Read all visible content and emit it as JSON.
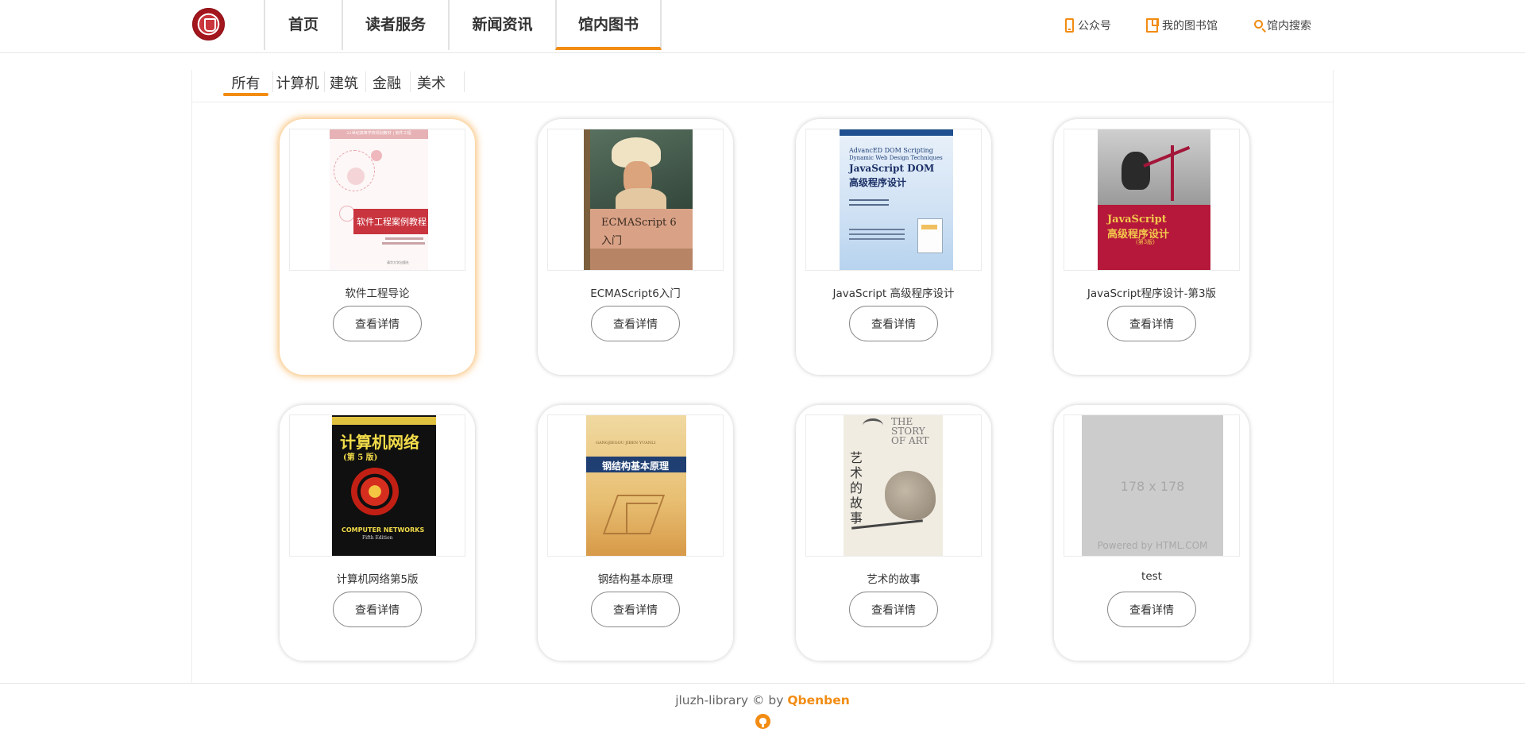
{
  "nav": {
    "items": [
      {
        "label": "首页"
      },
      {
        "label": "读者服务"
      },
      {
        "label": "新闻资讯"
      },
      {
        "label": "馆内图书"
      }
    ],
    "active": "馆内图书"
  },
  "top_links": {
    "wechat": "公众号",
    "my_library": "我的图书馆",
    "search": "馆内搜索"
  },
  "category_tabs": {
    "items": [
      "所有",
      "计算机",
      "建筑",
      "金融",
      "美术"
    ],
    "active": "所有"
  },
  "books": [
    {
      "title": "软件工程导论",
      "button": "查看详情",
      "cover": {
        "title": "软件工程案例教程",
        "series": "21世纪高等学校规划教材 | 软件工程",
        "publisher": "清华大学出版社"
      }
    },
    {
      "title": "ECMAScript6入门",
      "button": "查看详情",
      "cover": {
        "title": "ECMAScript 6",
        "subtitle": "入门"
      }
    },
    {
      "title": "JavaScript 高级程序设计",
      "button": "查看详情",
      "cover": {
        "title_en": "AdvancED DOM Scripting",
        "sub_en": "Dynamic Web Design Techniques",
        "title": "JavaScript DOM",
        "subtitle": "高级程序设计"
      }
    },
    {
      "title": "JavaScript程序设计-第3版",
      "button": "查看详情",
      "cover": {
        "title": "JavaScript",
        "subtitle": "高级程序设计",
        "edition": "(第3版)"
      }
    },
    {
      "title": "计算机网络第5版",
      "button": "查看详情",
      "cover": {
        "title": "计算机网络",
        "edition": "(第 5 版)",
        "title_en": "COMPUTER NETWORKS",
        "edition_en": "Fifth Edition"
      }
    },
    {
      "title": "钢结构基本原理",
      "button": "查看详情",
      "cover": {
        "title": "钢结构基本原理",
        "pinyin": "GANGJIEGOU JIBEN YUANLI"
      }
    },
    {
      "title": "艺术的故事",
      "button": "查看详情",
      "cover": {
        "title_en": "THE STORY OF ART",
        "title": "艺术的故事"
      }
    },
    {
      "title": "test",
      "button": "查看详情",
      "cover": {
        "placeholder_size": "178 x 178",
        "placeholder_credit": "Powered by HTML.COM"
      }
    }
  ],
  "footer": {
    "text": "jluzh-library © by ",
    "author": "Qbenben"
  },
  "colors": {
    "accent": "#f28c13",
    "highlight_glow": "#f5aa46"
  }
}
